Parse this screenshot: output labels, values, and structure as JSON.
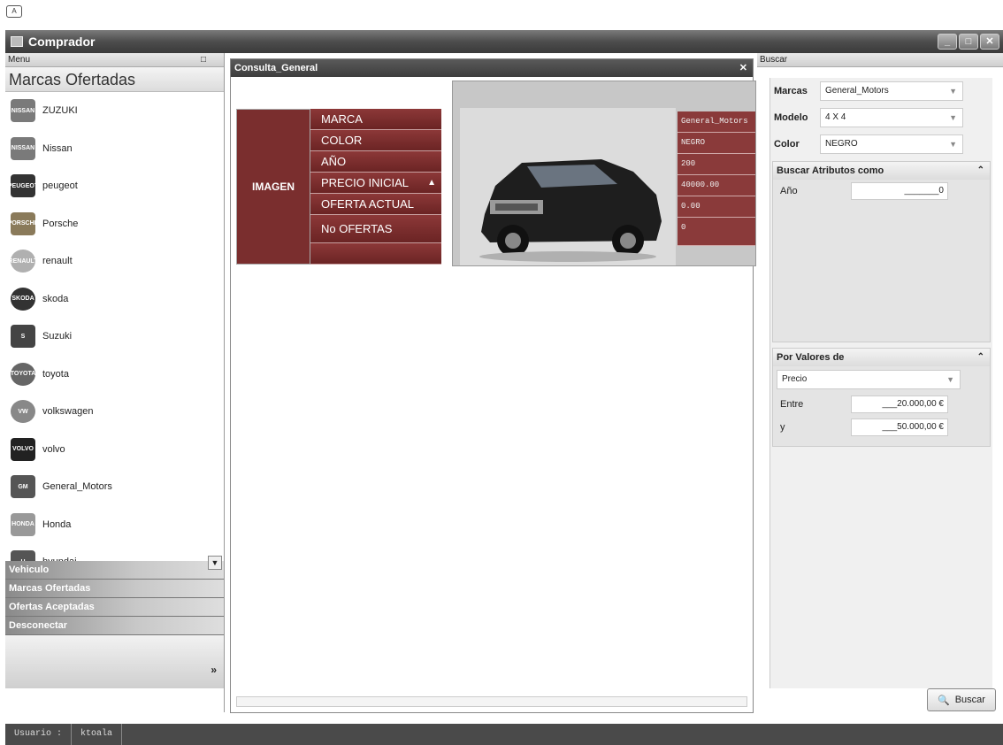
{
  "corner_tag": "A",
  "window": {
    "title": "Comprador",
    "buttons": [
      "_",
      "□",
      "✕"
    ]
  },
  "left": {
    "header": "Menu",
    "pin": "□",
    "section_title": "Marcas Ofertadas",
    "brands": [
      {
        "label": "ZUZUKI",
        "logo": "NISSAN",
        "color": "#7a7a7a"
      },
      {
        "label": "Nissan",
        "logo": "NISSAN",
        "color": "#7a7a7a"
      },
      {
        "label": "peugeot",
        "logo": "PEUGEOT",
        "color": "#333333"
      },
      {
        "label": "Porsche",
        "logo": "PORSCHE",
        "color": "#8a7a5a"
      },
      {
        "label": "renault",
        "logo": "RENAULT",
        "color": "#b0b0b0"
      },
      {
        "label": "skoda",
        "logo": "SKODA",
        "color": "#333333"
      },
      {
        "label": "Suzuki",
        "logo": "S",
        "color": "#444444"
      },
      {
        "label": "toyota",
        "logo": "TOYOTA",
        "color": "#666666"
      },
      {
        "label": "volkswagen",
        "logo": "VW",
        "color": "#888888"
      },
      {
        "label": "volvo",
        "logo": "VOLVO",
        "color": "#222222"
      },
      {
        "label": "General_Motors",
        "logo": "GM",
        "color": "#555555"
      },
      {
        "label": "Honda",
        "logo": "HONDA",
        "color": "#999999"
      },
      {
        "label": "hyundai",
        "logo": "H",
        "color": "#555555"
      }
    ],
    "nav": [
      "Vehiculo",
      "Marcas Ofertadas",
      "Ofertas Aceptadas",
      "Desconectar"
    ]
  },
  "center": {
    "tab": "Consulta_General",
    "image_label": "IMAGEN",
    "fields": [
      "MARCA",
      "COLOR",
      "AÑO",
      "PRECIO INICIAL",
      "OFERTA ACTUAL",
      "No OFERTAS"
    ],
    "values": [
      "General_Motors",
      "NEGRO",
      "200",
      "40000.00",
      "0.00",
      "0"
    ]
  },
  "right": {
    "header": "Buscar",
    "marca_label": "Marcas",
    "marca_value": "General_Motors",
    "modelo_label": "Modelo",
    "modelo_value": "4 X 4",
    "color_label": "Color",
    "color_value": "NEGRO",
    "attr_group": "Buscar Atributos como",
    "anio_label": "Año",
    "anio_value": "_______0",
    "valores_group": "Por Valores de",
    "precio_select": "Precio",
    "entre_label": "Entre",
    "entre_value": "___20.000,00 €",
    "y_label": "y",
    "y_value": "___50.000,00 €",
    "search_button": "Buscar"
  },
  "status": {
    "user_label": "Usuario :",
    "user_value": "ktoala"
  }
}
